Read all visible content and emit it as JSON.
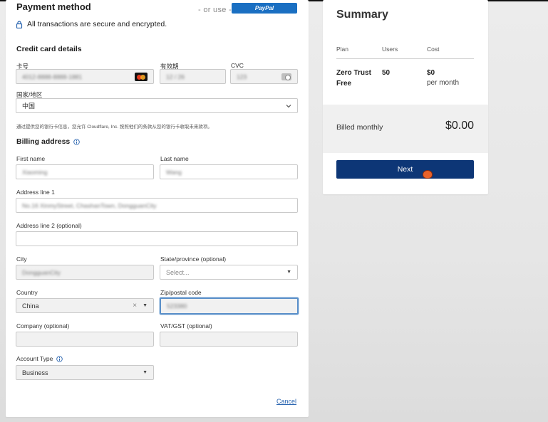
{
  "payment": {
    "title": "Payment method",
    "or_use": "- or use -",
    "paypal_label": "PayPal",
    "secure_text": "All transactions are secure and encrypted.",
    "card_section_title": "Credit card details",
    "card_number_label": "卡号",
    "card_number_value": "4012-8888-8888-1881",
    "expiry_label": "有效期",
    "expiry_value": "12 / 26",
    "cvc_label": "CVC",
    "cvc_value": "123",
    "country_region_label": "国家/地区",
    "country_region_value": "中国",
    "consent_note": "通过提供您的银行卡信息，您允许 Cloudflare, Inc. 按照他们的条款从您的银行卡收取未来款项。",
    "billing_title": "Billing address",
    "first_name_label": "First name",
    "first_name_value": "Xiaoming",
    "last_name_label": "Last name",
    "last_name_value": "Wang",
    "address1_label": "Address line 1",
    "address1_value": "No.16 XinmyStreet, ChashanTown, DongguanCity",
    "address2_label": "Address line 2 (optional)",
    "address2_value": "",
    "city_label": "City",
    "city_value": "DongguanCity",
    "state_label": "State/province (optional)",
    "state_placeholder": "Select...",
    "country_label": "Country",
    "country_value": "China",
    "zip_label": "Zip/postal code",
    "zip_value": "523380",
    "company_label": "Company (optional)",
    "company_value": "",
    "vat_label": "VAT/GST (optional)",
    "vat_value": "",
    "account_type_label": "Account Type",
    "account_type_value": "Business",
    "cancel_label": "Cancel"
  },
  "summary": {
    "title": "Summary",
    "col_plan": "Plan",
    "col_users": "Users",
    "col_cost": "Cost",
    "plan_line1": "Zero Trust",
    "plan_line2": "Free",
    "users": "50",
    "cost": "$0",
    "cost_period": "per month",
    "billed_label": "Billed monthly",
    "billed_amount": "$0.00",
    "next_label": "Next"
  },
  "colors": {
    "paypal": "#1a6fc2",
    "next_button": "#0d3676",
    "link": "#2a65b0",
    "focus": "#5b90c9"
  }
}
